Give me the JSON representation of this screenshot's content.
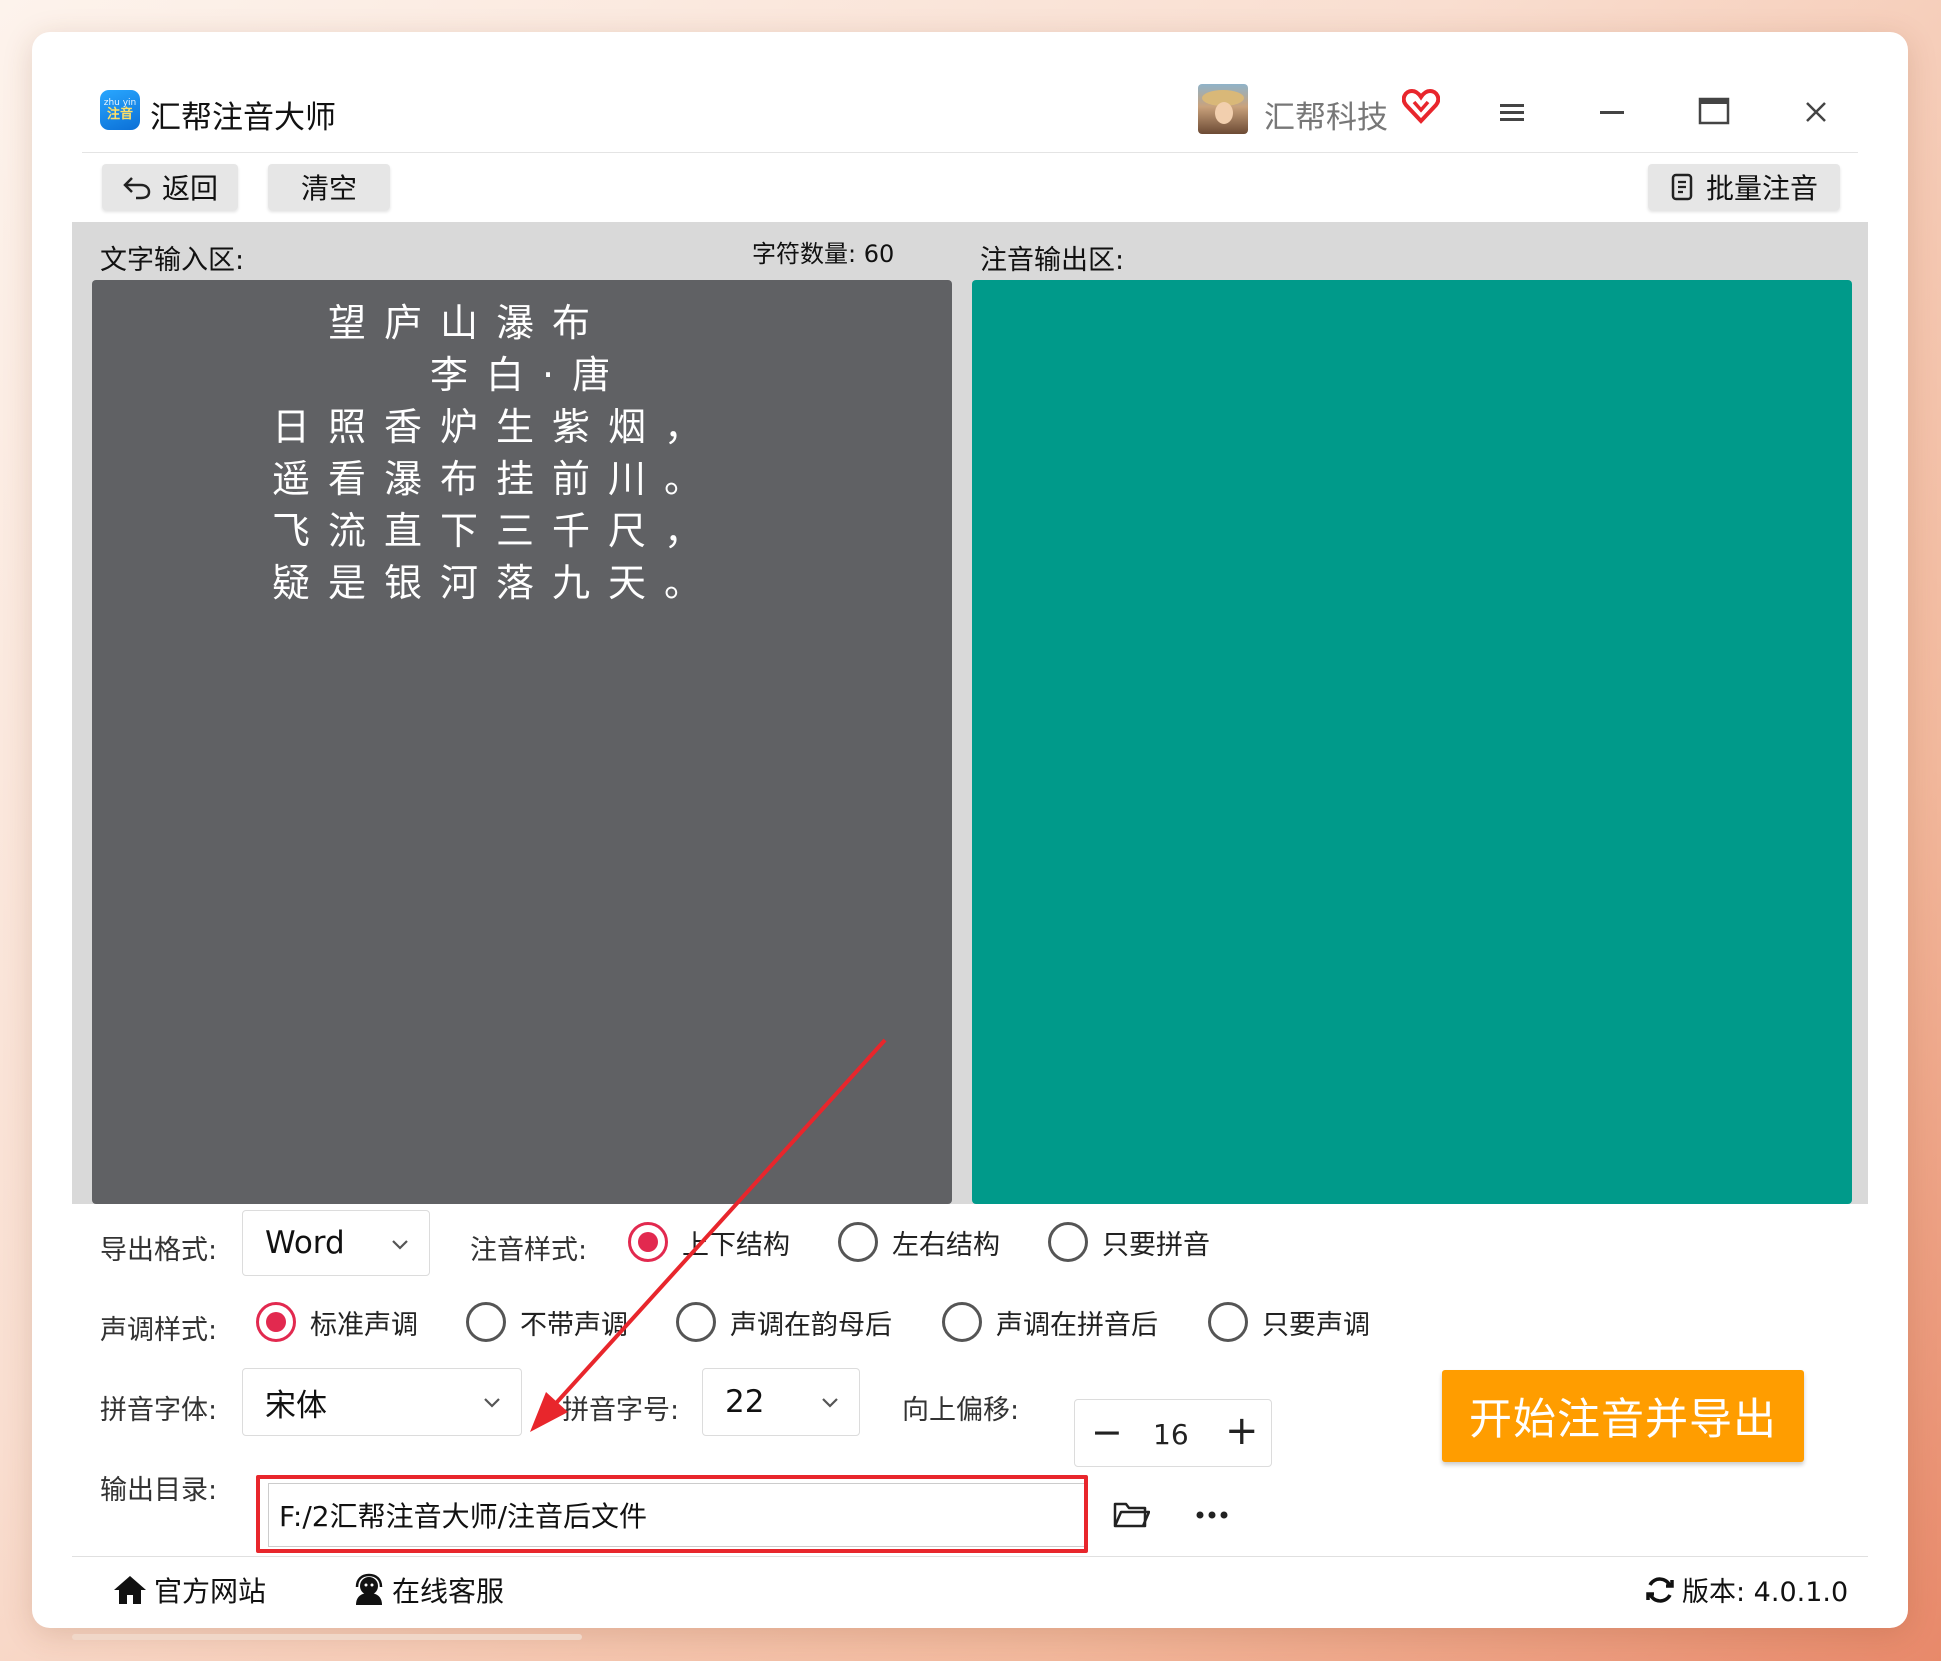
{
  "app": {
    "logo_line1": "zhu yin",
    "logo_line2": "注音",
    "title": "汇帮注音大师",
    "company": "汇帮科技"
  },
  "toolbar": {
    "back_label": "返回",
    "clear_label": "清空",
    "batch_label": "批量注音"
  },
  "input": {
    "label": "文字输入区:",
    "char_count_label": "字符数量: 60",
    "lines": [
      "望庐山瀑布",
      "李白·唐",
      "日照香炉生紫烟，",
      "遥看瀑布挂前川。",
      "飞流直下三千尺，",
      "疑是银河落九天。"
    ]
  },
  "output": {
    "label": "注音输出区:"
  },
  "settings": {
    "export_format_label": "导出格式:",
    "export_format_value": "Word",
    "style_label": "注音样式:",
    "style_options": [
      "上下结构",
      "左右结构",
      "只要拼音"
    ],
    "tone_label": "声调样式:",
    "tone_options": [
      "标准声调",
      "不带声调",
      "声调在韵母后",
      "声调在拼音后",
      "只要声调"
    ],
    "font_label": "拼音字体:",
    "font_value": "宋体",
    "size_label": "拼音字号:",
    "size_value": "22",
    "offset_label": "向上偏移:",
    "offset_value": "16",
    "dir_label": "输出目录:",
    "dir_value": "F:/2汇帮注音大师/注音后文件"
  },
  "actions": {
    "start_label": "开始注音并导出"
  },
  "footer": {
    "website_label": "官方网站",
    "service_label": "在线客服",
    "version_label": "版本: 4.0.1.0"
  },
  "colors": {
    "input_bg": "#606164",
    "output_bg": "#009a8a",
    "accent": "#e2294f",
    "start_button": "#ff9d00",
    "highlight": "#e8262c"
  }
}
